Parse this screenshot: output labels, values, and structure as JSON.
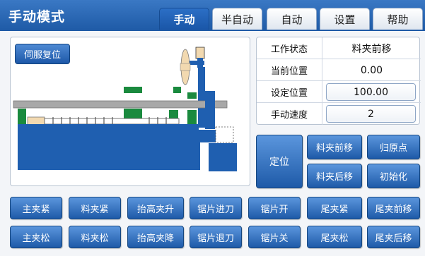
{
  "header": {
    "title": "手动模式",
    "tabs": [
      "手动",
      "半自动",
      "自动",
      "设置",
      "帮助"
    ],
    "active_tab": "手动"
  },
  "diagram": {
    "servo_reset_label": "伺服复位"
  },
  "status": {
    "rows": [
      {
        "label": "工作状态",
        "value": "料夹前移"
      },
      {
        "label": "当前位置",
        "value": "0.00"
      },
      {
        "label": "设定位置",
        "value": "100.00"
      },
      {
        "label": "手动速度",
        "value": "2"
      }
    ]
  },
  "actions": {
    "position": "定位",
    "clamp_forward": "料夹前移",
    "home": "归原点",
    "clamp_backward": "料夹后移",
    "initialize": "初始化"
  },
  "controls": {
    "row1": [
      "主夹紧",
      "料夹紧",
      "抬高夹升",
      "锯片进刀",
      "锯片开",
      "尾夹紧",
      "尾夹前移"
    ],
    "row2": [
      "主夹松",
      "料夹松",
      "抬高夹降",
      "锯片退刀",
      "锯片关",
      "尾夹松",
      "尾夹后移"
    ]
  },
  "colors": {
    "header": "#1e5aa6",
    "button": "#1e5aa8",
    "machine_blue": "#1f5fb0",
    "machine_green": "#1a8a3e",
    "rail_gray": "#a8a8a8"
  }
}
